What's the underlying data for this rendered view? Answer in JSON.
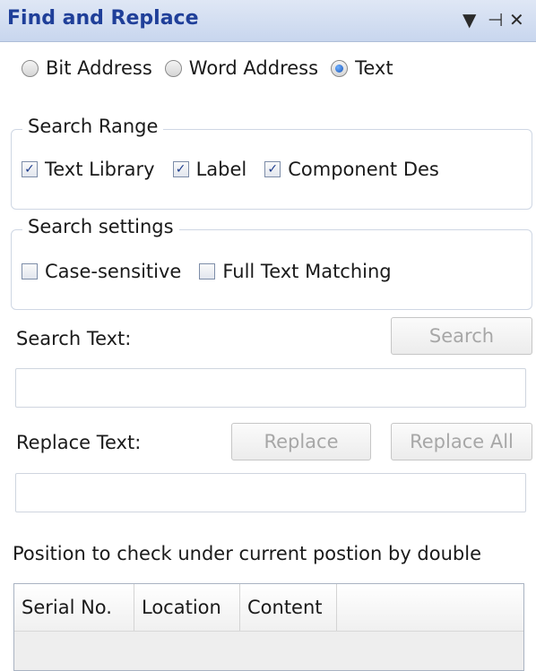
{
  "panel": {
    "title": "Find and Replace",
    "icons": {
      "dropdown": "▼",
      "pin": "⊣",
      "close": "✕"
    }
  },
  "address_type": {
    "options": [
      "Bit Address",
      "Word Address",
      "Text"
    ],
    "selected": "Text"
  },
  "search_range": {
    "legend": "Search Range",
    "options": [
      {
        "label": "Text Library",
        "checked": true
      },
      {
        "label": "Label",
        "checked": true
      },
      {
        "label": "Component Des",
        "checked": true
      }
    ]
  },
  "search_settings": {
    "legend": "Search settings",
    "options": [
      {
        "label": "Case-sensitive",
        "checked": false
      },
      {
        "label": "Full Text Matching",
        "checked": false
      }
    ]
  },
  "search": {
    "label": "Search Text:",
    "button": "Search",
    "value": ""
  },
  "replace": {
    "label": "Replace Text:",
    "button": "Replace",
    "button_all": "Replace All",
    "value": ""
  },
  "hint": "Position to check under current postion by double",
  "table": {
    "columns": [
      "Serial No.",
      "Location",
      "Content"
    ]
  }
}
